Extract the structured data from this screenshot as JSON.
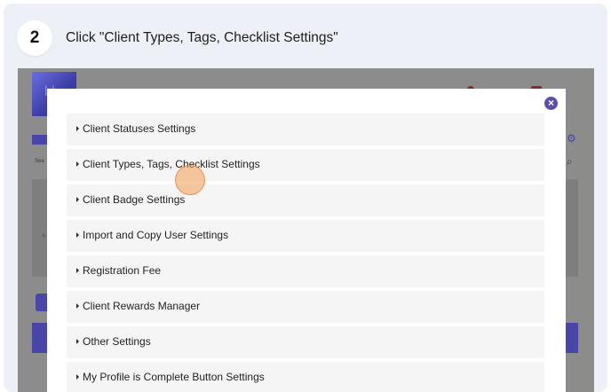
{
  "step": {
    "number": "2",
    "instruction": "Click \"Client Types, Tags, Checklist Settings\""
  },
  "background": {
    "search_hint": "Sea",
    "row_hint": "c"
  },
  "modal": {
    "close_label": "×",
    "items": [
      {
        "label": "Client Statuses Settings"
      },
      {
        "label": "Client Types, Tags, Checklist Settings"
      },
      {
        "label": "Client Badge Settings"
      },
      {
        "label": "Import and Copy User Settings"
      },
      {
        "label": "Registration Fee"
      },
      {
        "label": "Client Rewards Manager"
      },
      {
        "label": "Other Settings"
      },
      {
        "label": "My Profile is Complete Button Settings"
      }
    ]
  },
  "colors": {
    "accent": "#5a4fae",
    "click_marker": "#f29a52"
  }
}
